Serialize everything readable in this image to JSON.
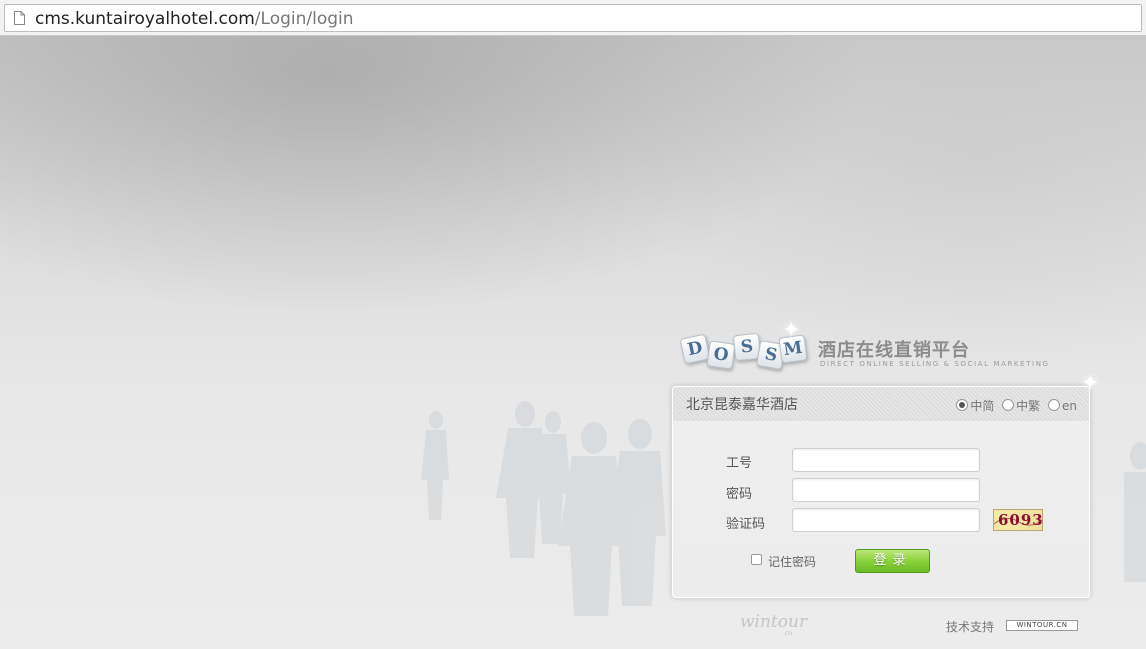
{
  "browser": {
    "url_host": "cms.kuntairoyalhotel.com",
    "url_path": "/Login/login"
  },
  "brand": {
    "logo_letters": [
      "D",
      "O",
      "S",
      "S",
      "M"
    ],
    "title_cn": "酒店在线直销平台",
    "title_en": "DIRECT ONLINE SELLING & SOCIAL MARKETING"
  },
  "login": {
    "hotel_name": "北京昆泰嘉华酒店",
    "languages": [
      {
        "label": "中简",
        "selected": true
      },
      {
        "label": "中繁",
        "selected": false
      },
      {
        "label": "en",
        "selected": false
      }
    ],
    "fields": {
      "employee_id_label": "工号",
      "password_label": "密码",
      "captcha_label": "验证码",
      "employee_id_value": "",
      "password_value": "",
      "captcha_value": ""
    },
    "captcha_code": "6093",
    "remember_label": "记住密码",
    "remember_checked": false,
    "submit_label": "登录"
  },
  "footer": {
    "partner_logo": "wintour",
    "partner_logo_suffix": ".cn",
    "tech_support_label": "技术支持",
    "tech_support_badge": "WINTOUR.CN"
  }
}
